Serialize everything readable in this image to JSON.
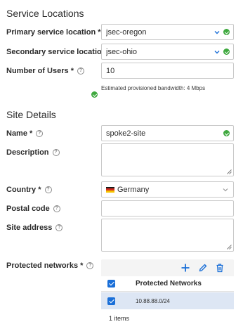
{
  "service_locations": {
    "title": "Service Locations",
    "primary": {
      "label": "Primary service location *",
      "value": "jsec-oregon"
    },
    "secondary": {
      "label": "Secondary service locatio...",
      "value": "jsec-ohio"
    },
    "users": {
      "label": "Number of Users *",
      "value": "10"
    },
    "bandwidth_note": "Estimated provisioned bandwidth:  4 Mbps"
  },
  "site_details": {
    "title": "Site Details",
    "name": {
      "label": "Name *",
      "value": "spoke2-site"
    },
    "description": {
      "label": "Description",
      "value": ""
    },
    "country": {
      "label": "Country *",
      "value": "Germany"
    },
    "postal_code": {
      "label": "Postal code",
      "value": ""
    },
    "site_address": {
      "label": "Site address",
      "value": ""
    },
    "protected_networks": {
      "label": "Protected networks *",
      "column_header": "Protected Networks",
      "rows": [
        "10.88.88.0/24"
      ],
      "footer": "1 items"
    }
  },
  "colors": {
    "accent": "#1a6fd8",
    "ok": "#3fa93f",
    "selected_row": "#dde6f4"
  },
  "icons": [
    "help-icon",
    "chevron-down-icon",
    "check-circle-icon",
    "add-icon",
    "edit-icon",
    "delete-icon",
    "resize-handle-icon",
    "flag-germany-icon"
  ]
}
